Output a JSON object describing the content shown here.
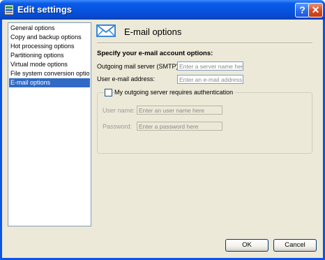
{
  "window": {
    "title": "Edit settings",
    "help_label": "?",
    "close_label": "✕"
  },
  "nav": {
    "items": [
      {
        "label": "General options",
        "selected": false
      },
      {
        "label": "Copy and backup options",
        "selected": false
      },
      {
        "label": "Hot processing options",
        "selected": false
      },
      {
        "label": "Partitioning options",
        "selected": false
      },
      {
        "label": "Virtual mode options",
        "selected": false
      },
      {
        "label": "File system conversion options",
        "selected": false
      },
      {
        "label": "E-mail options",
        "selected": true
      }
    ]
  },
  "header": {
    "icon": "envelope-icon",
    "title": "E-mail options"
  },
  "form": {
    "section_title": "Specify your e-mail account options:",
    "smtp_label": "Outgoing mail server (SMTP):",
    "smtp_placeholder": "Enter a server name here",
    "smtp_value": "",
    "email_label": "User e-mail address:",
    "email_placeholder": "Enter an e-mail address here",
    "email_value": "",
    "auth": {
      "checkbox_label": "My outgoing server requires authentication",
      "checked": false,
      "username_label": "User name:",
      "username_placeholder": "Enter an user name here",
      "password_label": "Password:",
      "password_placeholder": "Enter a password here"
    }
  },
  "buttons": {
    "ok": "OK",
    "cancel": "Cancel"
  },
  "colors": {
    "title_bar": "#0552de",
    "selection": "#316ac5",
    "dialog_bg": "#ece9d8"
  }
}
